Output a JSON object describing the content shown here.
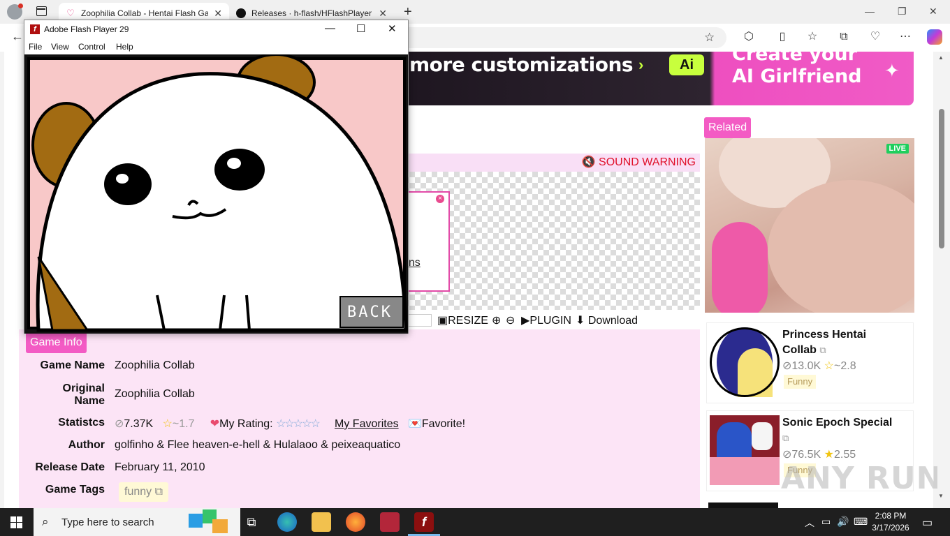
{
  "browser": {
    "tabs": [
      {
        "title": "Zoophilia Collab - Hentai Flash Ga",
        "active": true
      },
      {
        "title": "Releases · h-flash/HFlashPlayer",
        "active": false
      }
    ]
  },
  "banner": {
    "headline": "more customizations",
    "arrow": "›",
    "badge": "Ai",
    "cta_line1": "Create your",
    "cta_line2": "AI Girlfriend"
  },
  "player": {
    "sound_warning": "🔇 SOUND WARNING",
    "popup_link": "ons",
    "popup_close": "×",
    "controls": {
      "resize": "RESIZE",
      "plugin": "PLUGIN",
      "download": "Download"
    }
  },
  "flash_window": {
    "title": "Adobe Flash Player 29",
    "menu": [
      "File",
      "View",
      "Control",
      "Help"
    ],
    "stage_text": "BACK"
  },
  "game_info": {
    "tab_label": "Game Info",
    "game_name_label": "Game Name",
    "game_name": "Zoophilia Collab",
    "original_name_label_1": "Original",
    "original_name_label_2": "Name",
    "original_name": "Zoophilia Collab",
    "statistics_label": "Statistcs",
    "views": "7.37K",
    "rating": "~1.7",
    "my_rating_label": "My Rating:",
    "my_favorites": "My Favorites",
    "favorite_label": "Favorite!",
    "author_label": "Author",
    "author": "golfinho & Flee heaven-e-hell & Hulalaoo & peixeaquatico",
    "release_date_label": "Release Date",
    "release_date": "February 11, 2010",
    "tags_label": "Game Tags",
    "tag": "funny"
  },
  "related": {
    "tab_label": "Related",
    "live_badge": "LIVE",
    "cards": [
      {
        "title": "Princess Hentai Collab",
        "views": "13.0K",
        "rating": "~2.8",
        "tag": "Funny"
      },
      {
        "title": "Sonic Epoch Special",
        "views": "76.5K",
        "rating": "2.55",
        "tag": "Funny"
      }
    ]
  },
  "watermark": "ANY RUN",
  "taskbar": {
    "search_placeholder": "Type here to search",
    "time": "2:08 PM",
    "date": "3/17/2026"
  },
  "colors": {
    "accent_pink": "#f35bc4",
    "panel_pink": "#fce4f6",
    "warning_red": "#e0102a",
    "banner_lime": "#c8ff3d"
  }
}
